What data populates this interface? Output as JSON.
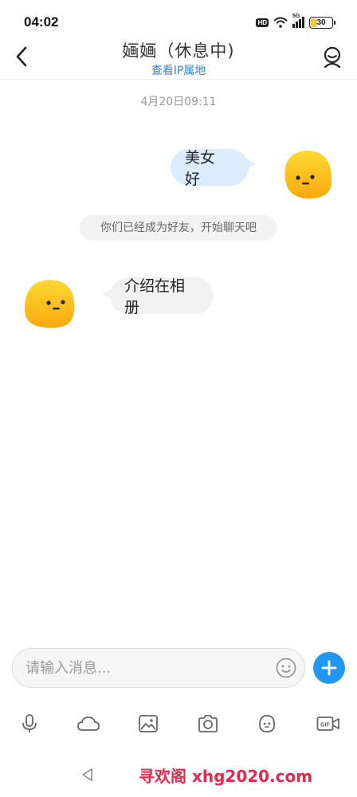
{
  "status_bar": {
    "time": "04:02",
    "hd_label": "HD",
    "signal_label": "5G",
    "battery_level": "30"
  },
  "header": {
    "title": "婳婳（休息中)",
    "subtitle": "查看IP属地"
  },
  "chat": {
    "timestamp": "4月20日09:11",
    "messages": [
      {
        "side": "right",
        "text": "美女 好"
      },
      {
        "side": "system",
        "text": "你们已经成为好友，开始聊天吧"
      },
      {
        "side": "left",
        "text": "介绍在相册"
      }
    ]
  },
  "input": {
    "placeholder": "请输入消息..."
  },
  "toolbar": {
    "icons": [
      "microphone-icon",
      "cloud-icon",
      "image-icon",
      "camera-icon",
      "sticker-icon",
      "gif-video-icon"
    ]
  },
  "watermark": "寻欢阁 xhg2020.com",
  "colors": {
    "accent": "#2196f3",
    "link": "#2c86d8",
    "sent_bubble": "#dcecfc",
    "received_bubble": "#f1f1f1",
    "avatar_yellow": "#fcc419",
    "watermark": "#e8284a"
  }
}
